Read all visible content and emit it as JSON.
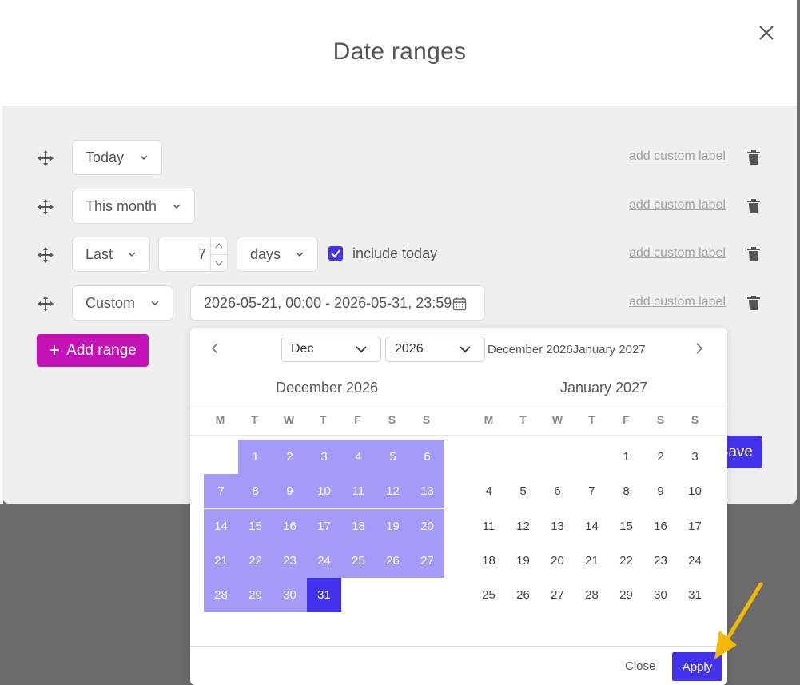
{
  "modal": {
    "title": "Date ranges",
    "add_range_label": "Add range",
    "save_label": "Save"
  },
  "rows": [
    {
      "preset": "Today",
      "custom_label": "add custom label"
    },
    {
      "preset": "This month",
      "custom_label": "add custom label"
    },
    {
      "preset": "Last",
      "amount": "7",
      "unit": "days",
      "include_today_label": "include today",
      "include_today_checked": true,
      "custom_label": "add custom label"
    },
    {
      "preset": "Custom",
      "date_range": "2026-05-21, 00:00 - 2026-05-31, 23:59",
      "custom_label": "add custom label"
    }
  ],
  "calendar": {
    "month_select": "Dec",
    "year_select": "2026",
    "header_text": "December 2026January 2027",
    "left_month_title": "December 2026",
    "right_month_title": "January 2027",
    "weekdays": [
      "M",
      "T",
      "W",
      "T",
      "F",
      "S",
      "S"
    ],
    "left_weeks": [
      [
        "",
        "1",
        "2",
        "3",
        "4",
        "5",
        "6"
      ],
      [
        "7",
        "8",
        "9",
        "10",
        "11",
        "12",
        "13"
      ],
      [
        "14",
        "15",
        "16",
        "17",
        "18",
        "19",
        "20"
      ],
      [
        "21",
        "22",
        "23",
        "24",
        "25",
        "26",
        "27"
      ],
      [
        "28",
        "29",
        "30",
        "31",
        "",
        "",
        ""
      ]
    ],
    "right_weeks": [
      [
        "",
        "",
        "",
        "",
        "1",
        "2",
        "3"
      ],
      [
        "4",
        "5",
        "6",
        "7",
        "8",
        "9",
        "10"
      ],
      [
        "11",
        "12",
        "13",
        "14",
        "15",
        "16",
        "17"
      ],
      [
        "18",
        "19",
        "20",
        "21",
        "22",
        "23",
        "24"
      ],
      [
        "25",
        "26",
        "27",
        "28",
        "29",
        "30",
        "31"
      ]
    ],
    "selected_end": "31",
    "close_label": "Close",
    "apply_label": "Apply"
  },
  "colors": {
    "accent": "#4433ee",
    "range_fill": "#a49bf8",
    "add_button": "#c411b8",
    "annotation_arrow": "#f5b800"
  }
}
